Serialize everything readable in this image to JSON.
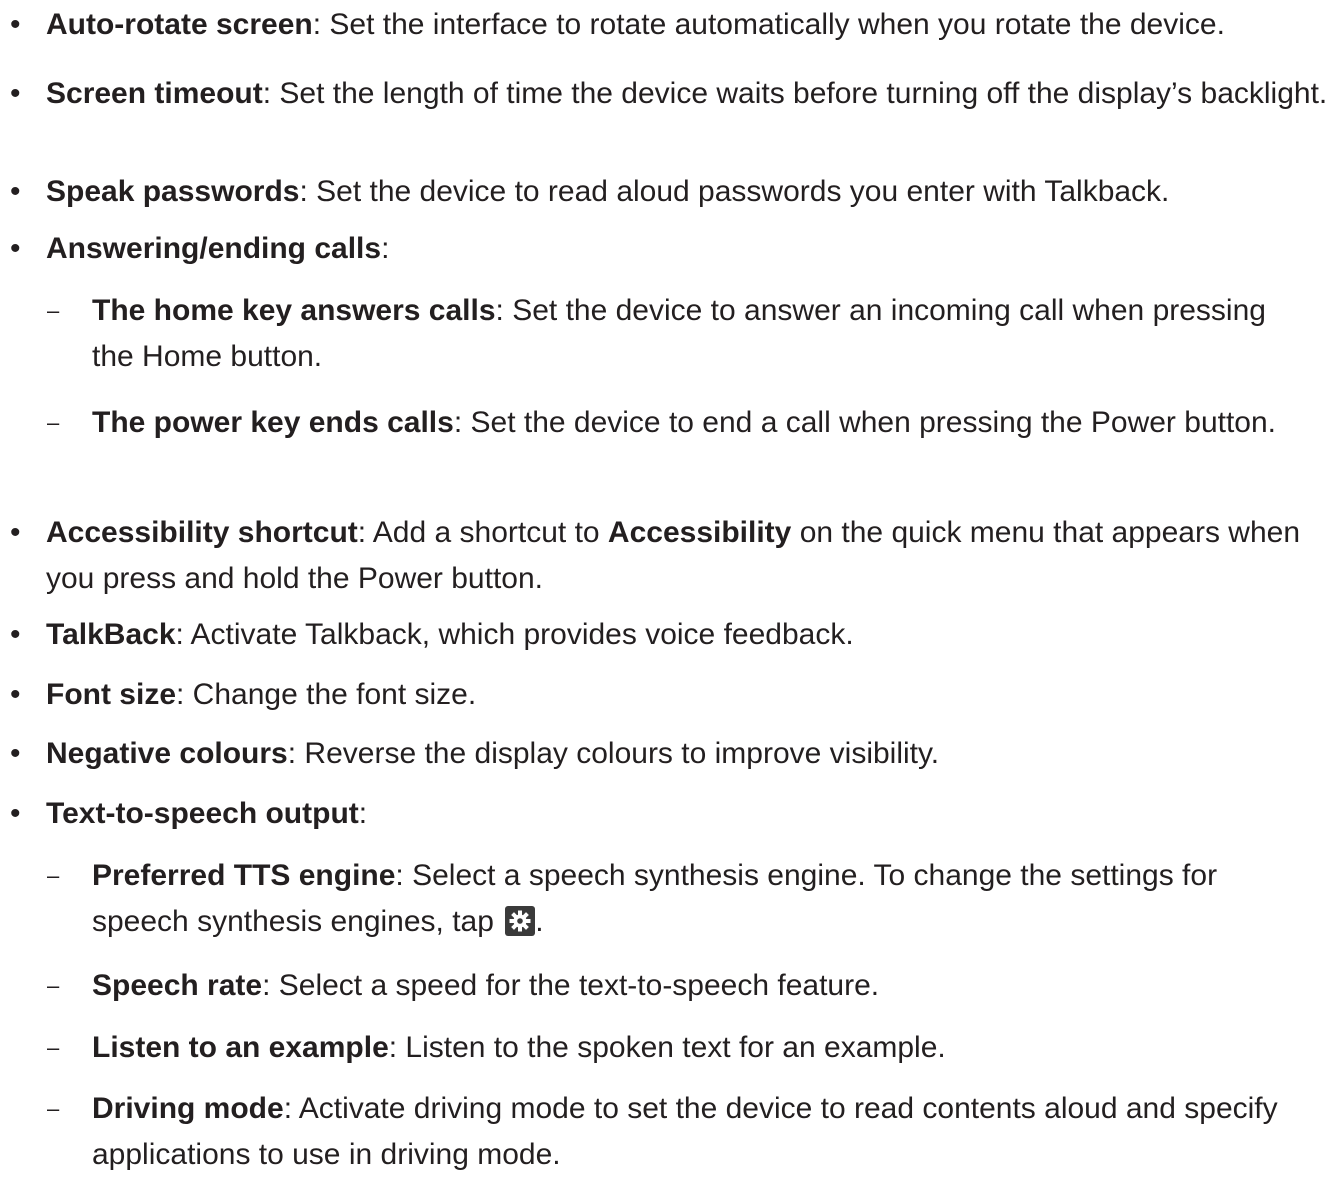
{
  "items": [
    {
      "term": "Auto-rotate screen",
      "desc": ": Set the interface to rotate automatically when you rotate the device."
    },
    {
      "term": "Screen timeout",
      "desc": ": Set the length of time the device waits before turning off the display’s backlight."
    },
    {
      "term": "Speak passwords",
      "desc": ": Set the device to read aloud passwords you enter with Talkback."
    },
    {
      "term": "Answering/ending calls",
      "desc": ":"
    },
    {
      "term": "The home key answers calls",
      "desc": ": Set the device to answer an incoming call when pressing the Home button."
    },
    {
      "term": "The power key ends calls",
      "desc": ": Set the device to end a call when pressing the Power button."
    },
    {
      "term": "Accessibility shortcut",
      "desc1": ": Add a shortcut to ",
      "term2": "Accessibility",
      "desc2": " on the quick menu that appears when you press and hold the Power button."
    },
    {
      "term": "TalkBack",
      "desc": ": Activate Talkback, which provides voice feedback."
    },
    {
      "term": "Font size",
      "desc": ": Change the font size."
    },
    {
      "term": "Negative colours",
      "desc": ": Reverse the display colours to improve visibility."
    },
    {
      "term": "Text-to-speech output",
      "desc": ":"
    },
    {
      "term": "Preferred TTS engine",
      "desc1": ": Select a speech synthesis engine. To change the settings for speech synthesis engines, tap ",
      "desc2": "."
    },
    {
      "term": "Speech rate",
      "desc": ": Select a speed for the text-to-speech feature."
    },
    {
      "term": "Listen to an example",
      "desc": ": Listen to the spoken text for an example."
    },
    {
      "term": "Driving mode",
      "desc": ": Activate driving mode to set the device to read contents aloud and specify applications to use in driving mode."
    }
  ],
  "bullet": "•",
  "dash": "–",
  "settings_icon": "gear-icon"
}
